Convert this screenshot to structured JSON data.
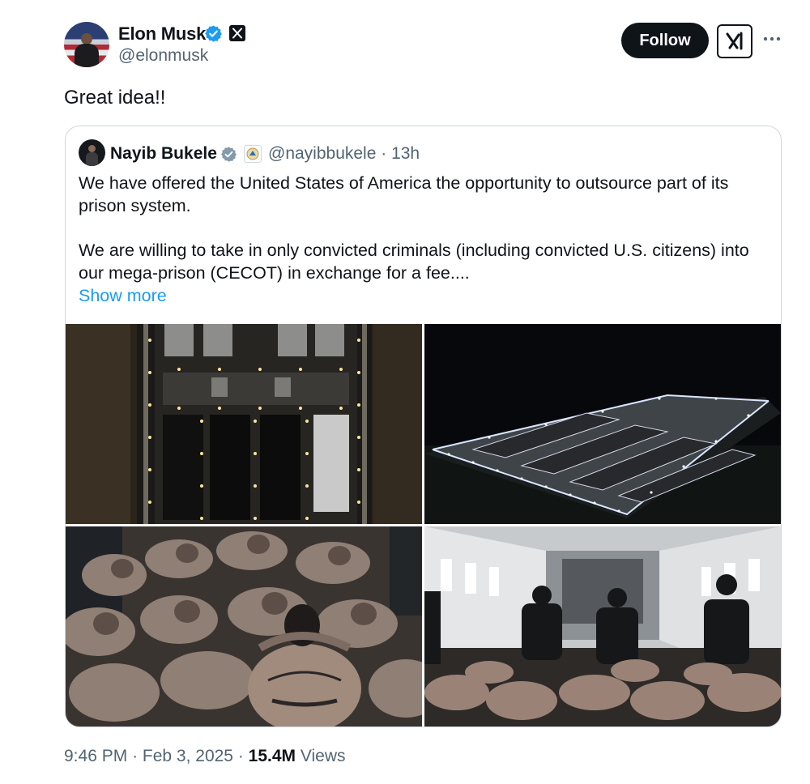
{
  "author": {
    "name": "Elon Musk",
    "handle": "@elonmusk"
  },
  "actions": {
    "follow_label": "Follow"
  },
  "tweet": {
    "text": "Great idea!!"
  },
  "quote": {
    "name": "Nayib Bukele",
    "handle": "@nayibbukele",
    "time": "13h",
    "paragraph1": "We have offered the United States of America the opportunity to outsource part of its prison system.",
    "paragraph2": "We are willing to take in only convicted criminals (including convicted U.S. citizens) into our mega-prison (CECOT) in exchange for a fee....",
    "show_more": "Show more"
  },
  "footer": {
    "time": "9:46 PM",
    "date": "Feb 3, 2025",
    "views_count": "15.4M",
    "views_label": "Views"
  },
  "colors": {
    "accent": "#1d9bf0",
    "text": "#0f1419",
    "secondary": "#536471",
    "border": "#cfd9de"
  }
}
